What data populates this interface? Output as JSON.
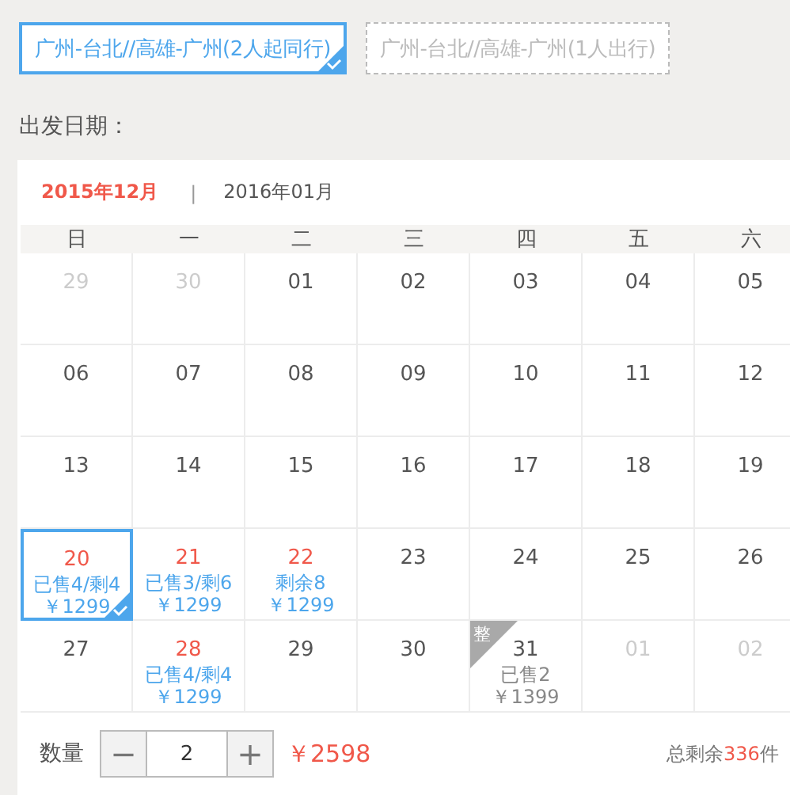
{
  "options": [
    {
      "label": "广州-台北//高雄-广州(2人起同行)",
      "selected": true
    },
    {
      "label": "广州-台北//高雄-广州(1人出行)",
      "selected": false
    }
  ],
  "date_label": "出发日期：",
  "months": [
    {
      "label": "2015年12月",
      "selected": true
    },
    {
      "label": "2016年01月",
      "selected": false
    }
  ],
  "month_separator": "|",
  "weekdays": [
    "日",
    "一",
    "二",
    "三",
    "四",
    "五",
    "六"
  ],
  "weeks": [
    [
      {
        "day": "29",
        "kind": "other",
        "selected": false
      },
      {
        "day": "30",
        "kind": "other",
        "selected": false
      },
      {
        "day": "01",
        "kind": "plain",
        "selected": false
      },
      {
        "day": "02",
        "kind": "plain",
        "selected": false
      },
      {
        "day": "03",
        "kind": "plain",
        "selected": false
      },
      {
        "day": "04",
        "kind": "plain",
        "selected": false
      },
      {
        "day": "05",
        "kind": "plain",
        "selected": false
      }
    ],
    [
      {
        "day": "06",
        "kind": "plain",
        "selected": false
      },
      {
        "day": "07",
        "kind": "plain",
        "selected": false
      },
      {
        "day": "08",
        "kind": "plain",
        "selected": false
      },
      {
        "day": "09",
        "kind": "plain",
        "selected": false
      },
      {
        "day": "10",
        "kind": "plain",
        "selected": false
      },
      {
        "day": "11",
        "kind": "plain",
        "selected": false
      },
      {
        "day": "12",
        "kind": "plain",
        "selected": false
      }
    ],
    [
      {
        "day": "13",
        "kind": "plain",
        "selected": false
      },
      {
        "day": "14",
        "kind": "plain",
        "selected": false
      },
      {
        "day": "15",
        "kind": "plain",
        "selected": false
      },
      {
        "day": "16",
        "kind": "plain",
        "selected": false
      },
      {
        "day": "17",
        "kind": "plain",
        "selected": false
      },
      {
        "day": "18",
        "kind": "plain",
        "selected": false
      },
      {
        "day": "19",
        "kind": "plain",
        "selected": false
      }
    ],
    [
      {
        "day": "20",
        "kind": "sale",
        "selected": true,
        "status": "已售4/剩4",
        "price": "￥1299"
      },
      {
        "day": "21",
        "kind": "sale",
        "selected": false,
        "status": "已售3/剩6",
        "price": "￥1299"
      },
      {
        "day": "22",
        "kind": "sale",
        "selected": false,
        "status": "剩余8",
        "price": "￥1299"
      },
      {
        "day": "23",
        "kind": "plain",
        "selected": false
      },
      {
        "day": "24",
        "kind": "plain",
        "selected": false
      },
      {
        "day": "25",
        "kind": "plain",
        "selected": false
      },
      {
        "day": "26",
        "kind": "plain",
        "selected": false
      }
    ],
    [
      {
        "day": "27",
        "kind": "plain",
        "selected": false
      },
      {
        "day": "28",
        "kind": "sale",
        "selected": false,
        "status": "已售4/剩4",
        "price": "￥1299"
      },
      {
        "day": "29",
        "kind": "plain",
        "selected": false
      },
      {
        "day": "30",
        "kind": "plain",
        "selected": false
      },
      {
        "day": "31",
        "kind": "closed",
        "selected": false,
        "badge": "整",
        "status": "已售2",
        "price": "￥1399"
      },
      {
        "day": "01",
        "kind": "other",
        "selected": false
      },
      {
        "day": "02",
        "kind": "other",
        "selected": false
      }
    ]
  ],
  "quantity": {
    "label": "数量",
    "minus": "−",
    "value": "2",
    "plus": "+"
  },
  "total": "￥2598",
  "remaining": {
    "prefix": "总剩余",
    "count": "336",
    "suffix": "件"
  }
}
